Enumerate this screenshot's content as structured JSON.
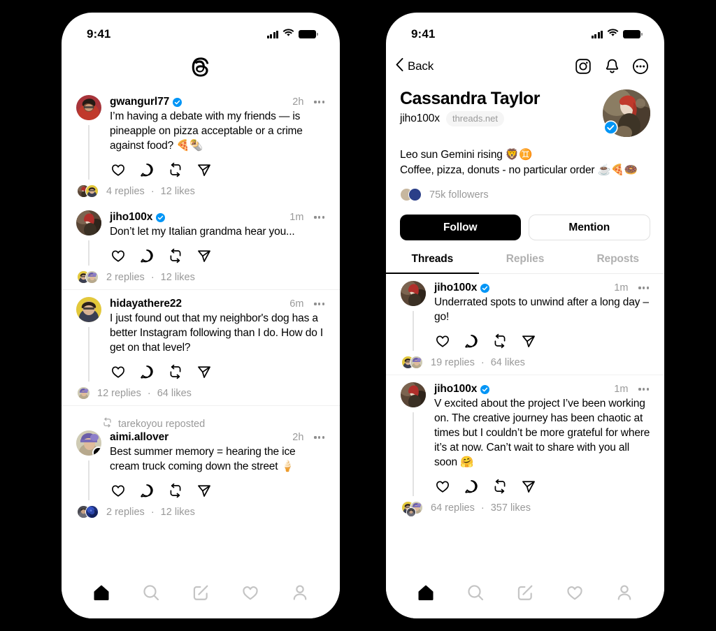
{
  "app": {
    "name": "Threads",
    "logo_icon": "threads-logo-icon"
  },
  "status_bar": {
    "time": "9:41",
    "cellular_icon": "cellular-bars-icon",
    "wifi_icon": "wifi-icon",
    "battery_icon": "battery-full-icon"
  },
  "left_screen": {
    "screen_name": "home-feed",
    "feed": [
      {
        "username": "gwangurl77",
        "verified": true,
        "time": "2h",
        "text": "I’m having a debate with my friends — is pineapple on pizza acceptable or a crime against food? 🍕🌯",
        "replies": "4 replies",
        "likes": "12 likes",
        "meta_separator": "·",
        "reply_avatar_count": 2,
        "thread_line": true,
        "divider_above": false,
        "repost_by": null,
        "follow_badge": false
      },
      {
        "username": "jiho100x",
        "verified": true,
        "time": "1m",
        "text": "Don’t let my Italian grandma hear you...",
        "replies": "2 replies",
        "likes": "12 likes",
        "meta_separator": "·",
        "reply_avatar_count": 2,
        "thread_line": true,
        "divider_above": false,
        "repost_by": null,
        "follow_badge": false
      },
      {
        "username": "hidayathere22",
        "verified": false,
        "time": "6m",
        "text": "I just found out that my neighbor's dog has a better Instagram following than I do. How do I get on that level?",
        "replies": "12 replies",
        "likes": "64 likes",
        "meta_separator": "·",
        "reply_avatar_count": 1,
        "thread_line": true,
        "divider_above": true,
        "repost_by": null,
        "follow_badge": false
      },
      {
        "username": "aimi.allover",
        "verified": false,
        "time": "2h",
        "text": "Best summer memory = hearing the ice cream truck coming down the street 🍦",
        "replies": "2 replies",
        "likes": "12 likes",
        "meta_separator": "·",
        "reply_avatar_count": 2,
        "thread_line": true,
        "divider_above": true,
        "repost_by": "tarekoyou reposted",
        "follow_badge": true,
        "follow_badge_label": "+"
      }
    ],
    "post_actions": [
      {
        "icon": "heart-icon",
        "label": "Like"
      },
      {
        "icon": "comment-icon",
        "label": "Reply"
      },
      {
        "icon": "repost-icon",
        "label": "Repost"
      },
      {
        "icon": "share-icon",
        "label": "Share"
      }
    ],
    "tabbar": [
      {
        "icon": "home-icon",
        "label": "Home",
        "active": true
      },
      {
        "icon": "search-icon",
        "label": "Search",
        "active": false
      },
      {
        "icon": "compose-icon",
        "label": "Compose",
        "active": false
      },
      {
        "icon": "heart-icon",
        "label": "Activity",
        "active": false
      },
      {
        "icon": "profile-icon",
        "label": "Profile",
        "active": false
      }
    ]
  },
  "right_screen": {
    "screen_name": "profile",
    "nav": {
      "back_label": "Back",
      "back_icon": "chevron-left-icon",
      "icons": [
        {
          "icon": "instagram-icon",
          "label": "Instagram"
        },
        {
          "icon": "bell-icon",
          "label": "Notifications"
        },
        {
          "icon": "more-circle-icon",
          "label": "More"
        }
      ]
    },
    "profile": {
      "display_name": "Cassandra Taylor",
      "handle": "jiho100x",
      "domain_chip": "threads.net",
      "verified": true,
      "bio_line_1": "Leo sun Gemini rising 🦁♊",
      "bio_line_2": "Coffee, pizza, donuts - no particular order ☕🍕🍩",
      "followers": "75k followers",
      "follow_button": "Follow",
      "mention_button": "Mention"
    },
    "tabs": [
      {
        "label": "Threads",
        "active": true
      },
      {
        "label": "Replies",
        "active": false
      },
      {
        "label": "Reposts",
        "active": false
      }
    ],
    "posts": [
      {
        "username": "jiho100x",
        "verified": true,
        "time": "1m",
        "text": "Underrated spots to unwind after a long day – go!",
        "replies": "19 replies",
        "likes": "64 likes",
        "meta_separator": "·",
        "reply_avatar_count": 2,
        "divider_above": false
      },
      {
        "username": "jiho100x",
        "verified": true,
        "time": "1m",
        "text": "V excited about the project I’ve been working on. The creative journey has been chaotic at times but I couldn’t be more grateful for where it’s at now. Can’t wait to share with you all soon 🤗",
        "replies": "64 replies",
        "likes": "357 likes",
        "meta_separator": "·",
        "reply_avatar_count": 3,
        "divider_above": true
      }
    ],
    "tabbar": [
      {
        "icon": "home-icon",
        "label": "Home",
        "active": true
      },
      {
        "icon": "search-icon",
        "label": "Search",
        "active": false
      },
      {
        "icon": "compose-icon",
        "label": "Compose",
        "active": false
      },
      {
        "icon": "heart-icon",
        "label": "Activity",
        "active": false
      },
      {
        "icon": "profile-icon",
        "label": "Profile",
        "active": false
      }
    ]
  },
  "colors": {
    "background": "#000000",
    "surface": "#ffffff",
    "text_primary": "#000000",
    "text_secondary": "#999999",
    "verified_blue": "#0095f6",
    "divider": "#f0f0f0",
    "chip_bg": "#f5f5f5"
  }
}
